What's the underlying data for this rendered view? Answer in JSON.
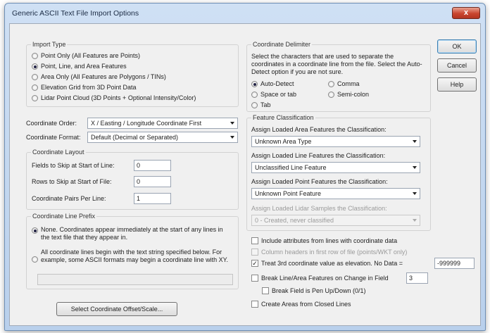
{
  "window": {
    "title": "Generic ASCII Text File Import Options",
    "close_glyph": "x"
  },
  "import_type": {
    "legend": "Import Type",
    "options": [
      {
        "label": "Point Only (All Features are Points)",
        "checked": false
      },
      {
        "label": "Point, Line, and Area Features",
        "checked": true
      },
      {
        "label": "Area Only (All Features are Polygons / TINs)",
        "checked": false
      },
      {
        "label": "Elevation Grid from 3D Point Data",
        "checked": false
      },
      {
        "label": "Lidar Point Cloud (3D Points + Optional Intensity/Color)",
        "checked": false
      }
    ]
  },
  "coordinate_order": {
    "label": "Coordinate Order:",
    "value": "X / Easting / Longitude Coordinate First"
  },
  "coordinate_format": {
    "label": "Coordinate Format:",
    "value": "Default (Decimal or Separated)"
  },
  "coordinate_layout": {
    "legend": "Coordinate Layout",
    "fields": [
      {
        "label": "Fields to Skip at Start of Line:",
        "value": "0"
      },
      {
        "label": "Rows to Skip at Start of File:",
        "value": "0"
      },
      {
        "label": "Coordinate Pairs Per Line:",
        "value": "1"
      }
    ]
  },
  "line_prefix": {
    "legend": "Coordinate Line Prefix",
    "option_none": "None. Coordinates appear immediately at the start of any lines in the text file that they appear in.",
    "option_prefix": "All coordinate lines begin with the text string specified below. For example, some ASCII formats may begin a coordinate line with XY.",
    "prefix_value": ""
  },
  "offset_button": "Select Coordinate Offset/Scale...",
  "delimiter": {
    "legend": "Coordinate Delimiter",
    "description": "Select the characters that are used to separate the coordinates in a coordinate line from the file. Select the Auto-Detect option if you are not sure.",
    "options": [
      {
        "label": "Auto-Detect",
        "checked": true
      },
      {
        "label": "Comma",
        "checked": false
      },
      {
        "label": "Space or tab",
        "checked": false
      },
      {
        "label": "Semi-colon",
        "checked": false
      },
      {
        "label": "Tab",
        "checked": false
      }
    ]
  },
  "classification": {
    "legend": "Feature Classification",
    "area_label": "Assign Loaded Area Features the Classification:",
    "area_value": "Unknown Area Type",
    "line_label": "Assign Loaded Line Features the Classification:",
    "line_value": "Unclassified Line Feature",
    "point_label": "Assign Loaded Point Features the Classification:",
    "point_value": "Unknown Point Feature",
    "lidar_label": "Assign Loaded Lidar Samples the Classification:",
    "lidar_value": "0 - Created, never classified"
  },
  "options": {
    "include_attributes": {
      "label": "Include attributes from lines with coordinate data",
      "checked": false
    },
    "column_headers": {
      "label": "Column headers in first row of file (points/WKT only)",
      "checked": false
    },
    "treat_3rd": {
      "label": "Treat 3rd coordinate value as elevation. No Data =",
      "checked": true,
      "nodata": "-999999"
    },
    "break_line": {
      "label": "Break Line/Area Features on Change in Field",
      "checked": false,
      "field": "3"
    },
    "break_field_pen": {
      "label": "Break Field is Pen Up/Down (0/1)",
      "checked": false
    },
    "create_areas": {
      "label": "Create Areas from Closed Lines",
      "checked": false
    }
  },
  "buttons": {
    "ok": "OK",
    "cancel": "Cancel",
    "help": "Help"
  }
}
